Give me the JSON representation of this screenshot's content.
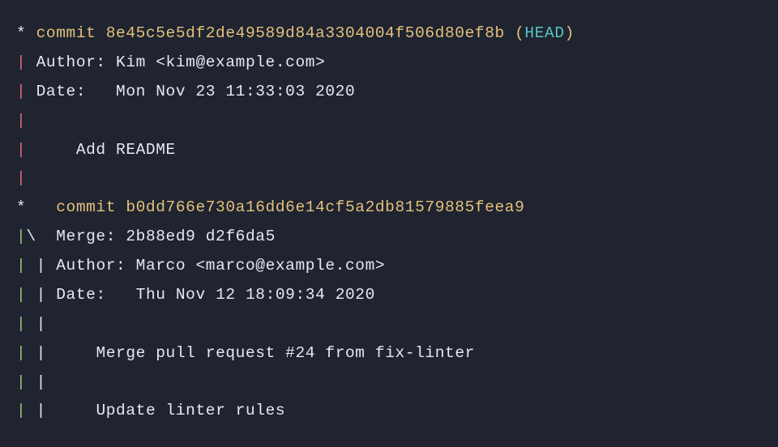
{
  "lines": [
    {
      "segments": [
        {
          "cls": "fg-default",
          "text": "* "
        },
        {
          "cls": "fg-yellow",
          "text": "commit 8e45c5e5df2de49589d84a3304004f506d80ef8b"
        },
        {
          "cls": "fg-yellow",
          "text": " ("
        },
        {
          "cls": "fg-cyan",
          "text": "HEAD"
        },
        {
          "cls": "fg-yellow",
          "text": ")"
        }
      ]
    },
    {
      "segments": [
        {
          "cls": "fg-red",
          "text": "|"
        },
        {
          "cls": "fg-default",
          "text": " Author: Kim <kim@example.com>"
        }
      ]
    },
    {
      "segments": [
        {
          "cls": "fg-red",
          "text": "|"
        },
        {
          "cls": "fg-default",
          "text": " Date:   Mon Nov 23 11:33:03 2020"
        }
      ]
    },
    {
      "segments": [
        {
          "cls": "fg-red",
          "text": "|"
        }
      ]
    },
    {
      "segments": [
        {
          "cls": "fg-red",
          "text": "|"
        },
        {
          "cls": "fg-default",
          "text": "     Add README"
        }
      ]
    },
    {
      "segments": [
        {
          "cls": "fg-red",
          "text": "|"
        }
      ]
    },
    {
      "segments": [
        {
          "cls": "fg-default",
          "text": "*   "
        },
        {
          "cls": "fg-yellow",
          "text": "commit b0dd766e730a16dd6e14cf5a2db81579885feea9"
        }
      ]
    },
    {
      "segments": [
        {
          "cls": "fg-green",
          "text": "|"
        },
        {
          "cls": "fg-default",
          "text": "\\"
        },
        {
          "cls": "fg-default",
          "text": "  Merge: 2b88ed9 d2f6da5"
        }
      ]
    },
    {
      "segments": [
        {
          "cls": "fg-green",
          "text": "|"
        },
        {
          "cls": "fg-default",
          "text": " "
        },
        {
          "cls": "fg-default",
          "text": "|"
        },
        {
          "cls": "fg-default",
          "text": " Author: Marco <marco@example.com>"
        }
      ]
    },
    {
      "segments": [
        {
          "cls": "fg-green",
          "text": "|"
        },
        {
          "cls": "fg-default",
          "text": " "
        },
        {
          "cls": "fg-default",
          "text": "|"
        },
        {
          "cls": "fg-default",
          "text": " Date:   Thu Nov 12 18:09:34 2020"
        }
      ]
    },
    {
      "segments": [
        {
          "cls": "fg-green",
          "text": "|"
        },
        {
          "cls": "fg-default",
          "text": " "
        },
        {
          "cls": "fg-default",
          "text": "|"
        }
      ]
    },
    {
      "segments": [
        {
          "cls": "fg-green",
          "text": "|"
        },
        {
          "cls": "fg-default",
          "text": " "
        },
        {
          "cls": "fg-default",
          "text": "|"
        },
        {
          "cls": "fg-default",
          "text": "     Merge pull request #24 from fix-linter"
        }
      ]
    },
    {
      "segments": [
        {
          "cls": "fg-green",
          "text": "|"
        },
        {
          "cls": "fg-default",
          "text": " "
        },
        {
          "cls": "fg-default",
          "text": "|"
        }
      ]
    },
    {
      "segments": [
        {
          "cls": "fg-green",
          "text": "|"
        },
        {
          "cls": "fg-default",
          "text": " "
        },
        {
          "cls": "fg-default",
          "text": "|"
        },
        {
          "cls": "fg-default",
          "text": "     Update linter rules"
        }
      ]
    }
  ]
}
